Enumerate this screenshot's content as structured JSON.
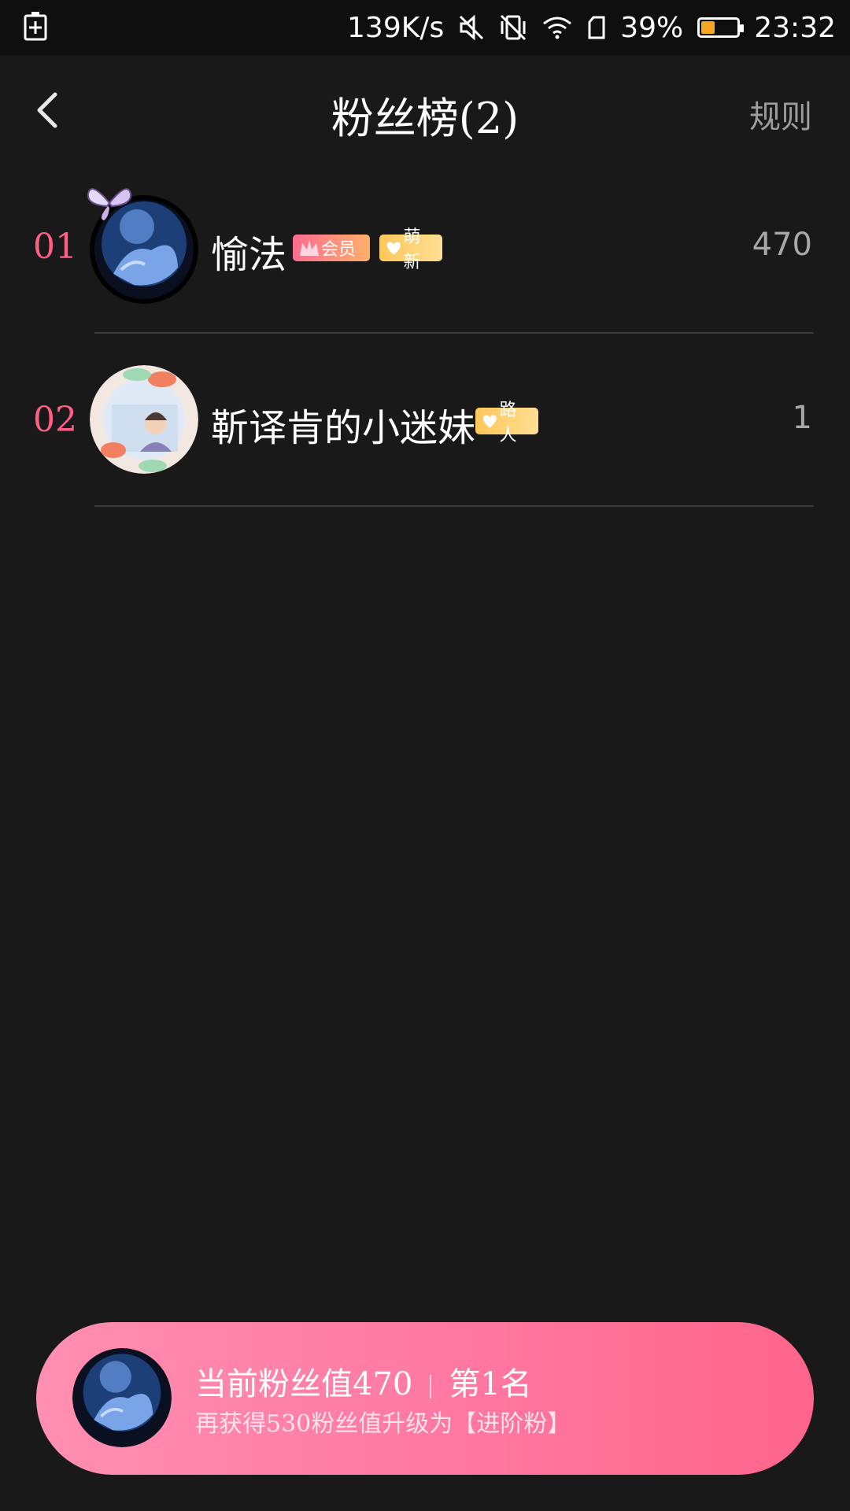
{
  "status_bar": {
    "net_speed": "139K/s",
    "battery": "39%",
    "battery_level": 0.39,
    "time": "23:32",
    "icons": [
      "battery-saver-icon",
      "mute-icon",
      "vibrate-off-icon",
      "wifi-icon",
      "sim-icon",
      "battery-icon"
    ]
  },
  "header": {
    "title": "粉丝榜(2)",
    "rules_label": "规则"
  },
  "fans": [
    {
      "rank": "01",
      "name": "愉法",
      "member_badge": "会员",
      "level_badge": "萌新",
      "score": "470"
    },
    {
      "rank": "02",
      "name": "靳译肯的小迷妹",
      "level_badge": "路人",
      "score": "1"
    }
  ],
  "banner": {
    "fan_value": "当前粉丝值470",
    "rank": "第1名",
    "hint": "再获得530粉丝值升级为【进阶粉】"
  },
  "colors": {
    "background": "#1a1919",
    "rank": "#ff5f86",
    "banner_start": "#ff8fb1",
    "banner_end": "#ff658c"
  }
}
